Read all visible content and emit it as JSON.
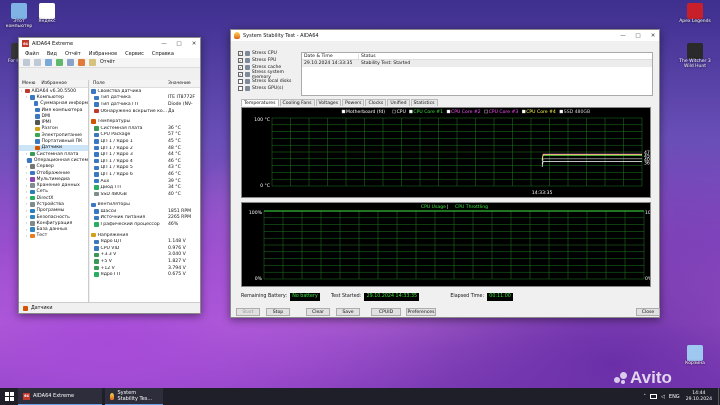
{
  "desktop": {
    "icons_left": [
      {
        "label": "Этот компьютер",
        "icon": "computer-icon",
        "color": "#7fb3e6"
      },
      {
        "label": "Яндекс",
        "icon": "yandex-icon",
        "color": "#ffffff"
      },
      {
        "label": "For Honor",
        "icon": "game-icon",
        "color": "#3a3a3a"
      }
    ],
    "icons_right": [
      {
        "label": "Apex Legends",
        "icon": "apex-icon",
        "color": "#c8202a"
      },
      {
        "label": "The Witcher 3 Wild Hunt",
        "icon": "witcher-icon",
        "color": "#2a2a2a"
      },
      {
        "label": "Корзина",
        "icon": "recycle-bin-icon",
        "color": "#9ec8ef"
      }
    ],
    "watermark": "Avito"
  },
  "aida": {
    "title": "AIDA64 Extreme",
    "menu": [
      "Файл",
      "Вид",
      "Отчёт",
      "Избранное",
      "Сервис",
      "Справка"
    ],
    "toolbar_report": "Отчёт",
    "tree_header": [
      "Меню",
      "Избранное"
    ],
    "tree": [
      {
        "label": "AIDA64 v6.30.5500",
        "indent": 0,
        "color": "#c0392b"
      },
      {
        "label": "Компьютер",
        "indent": 1,
        "color": "#3b78c2"
      },
      {
        "label": "Суммарная информ",
        "indent": 2,
        "color": "#3b78c2"
      },
      {
        "label": "Имя компьютера",
        "indent": 2,
        "color": "#3b78c2"
      },
      {
        "label": "DMI",
        "indent": 2,
        "color": "#3b78c2"
      },
      {
        "label": "IPMI",
        "indent": 2,
        "color": "#555555"
      },
      {
        "label": "Разгон",
        "indent": 2,
        "color": "#d4a017"
      },
      {
        "label": "Электропитание",
        "indent": 2,
        "color": "#3aa655"
      },
      {
        "label": "Портативный ПК",
        "indent": 2,
        "color": "#3b78c2"
      },
      {
        "label": "Датчики",
        "indent": 2,
        "color": "#d35400"
      },
      {
        "label": "Системная плата",
        "indent": 1,
        "color": "#3a9a55"
      },
      {
        "label": "Операционная система",
        "indent": 1,
        "color": "#3b78c2"
      },
      {
        "label": "Сервер",
        "indent": 1,
        "color": "#777777"
      },
      {
        "label": "Отображение",
        "indent": 1,
        "color": "#3b78c2"
      },
      {
        "label": "Мультимедиа",
        "indent": 1,
        "color": "#8e44ad"
      },
      {
        "label": "Хранение данных",
        "indent": 1,
        "color": "#7f8c8d"
      },
      {
        "label": "Сеть",
        "indent": 1,
        "color": "#2980b9"
      },
      {
        "label": "DirectX",
        "indent": 1,
        "color": "#27ae60"
      },
      {
        "label": "Устройства",
        "indent": 1,
        "color": "#7f8c8d"
      },
      {
        "label": "Программы",
        "indent": 1,
        "color": "#2980b9"
      },
      {
        "label": "Безопасность",
        "indent": 1,
        "color": "#2e86c1"
      },
      {
        "label": "Конфигурация",
        "indent": 1,
        "color": "#7f8c8d"
      },
      {
        "label": "База данных",
        "indent": 1,
        "color": "#2e86c1"
      },
      {
        "label": "Тест",
        "indent": 1,
        "color": "#e67e22"
      }
    ],
    "list_header": [
      "Поле",
      "Значение"
    ],
    "list": [
      {
        "type": "sec",
        "label": "Свойства датчика",
        "value": "",
        "color": "#3b78c2"
      },
      {
        "type": "row",
        "label": "Тип датчика",
        "value": "ITE IT8772F",
        "color": "#3b78c2"
      },
      {
        "type": "row",
        "label": "Тип датчика ГП",
        "value": "Diode (NV-",
        "color": "#3b78c2"
      },
      {
        "type": "row",
        "label": "Обнаружено вскрытие ко...",
        "value": "Да",
        "color": "#c0392b"
      },
      {
        "type": "gap"
      },
      {
        "type": "sec",
        "label": "Температуры",
        "value": "",
        "color": "#d35400"
      },
      {
        "type": "row",
        "label": "Системная плата",
        "value": "36 °C",
        "color": "#3a9a55"
      },
      {
        "type": "row",
        "label": "CPU Package",
        "value": "57 °C",
        "color": "#3b78c2"
      },
      {
        "type": "row",
        "label": "ЦП 1 / Ядро 1",
        "value": "45 °C",
        "color": "#3b78c2"
      },
      {
        "type": "row",
        "label": "ЦП 1 / Ядро 2",
        "value": "48 °C",
        "color": "#3b78c2"
      },
      {
        "type": "row",
        "label": "ЦП 1 / Ядро 3",
        "value": "44 °C",
        "color": "#3b78c2"
      },
      {
        "type": "row",
        "label": "ЦП 1 / Ядро 4",
        "value": "46 °C",
        "color": "#3b78c2"
      },
      {
        "type": "row",
        "label": "ЦП 1 / Ядро 5",
        "value": "43 °C",
        "color": "#3b78c2"
      },
      {
        "type": "row",
        "label": "ЦП 1 / Ядро 6",
        "value": "46 °C",
        "color": "#3b78c2"
      },
      {
        "type": "row",
        "label": "Aux",
        "value": "39 °C",
        "color": "#3b78c2"
      },
      {
        "type": "row",
        "label": "Диод ГП",
        "value": "34 °C",
        "color": "#27ae60"
      },
      {
        "type": "row",
        "label": "SSD 480GB",
        "value": "40 °C",
        "color": "#7f8c8d"
      },
      {
        "type": "gap"
      },
      {
        "type": "sec",
        "label": "Вентиляторы",
        "value": "",
        "color": "#3b78c2"
      },
      {
        "type": "row",
        "label": "Шасси",
        "value": "1851 RPM",
        "color": "#3b78c2"
      },
      {
        "type": "row",
        "label": "Источник питания",
        "value": "2265 RPM",
        "color": "#3b78c2"
      },
      {
        "type": "row",
        "label": "Графический процессор",
        "value": "46%",
        "color": "#27ae60"
      },
      {
        "type": "gap"
      },
      {
        "type": "sec",
        "label": "Напряжения",
        "value": "",
        "color": "#d4a017"
      },
      {
        "type": "row",
        "label": "Ядро ЦП",
        "value": "1.148 V",
        "color": "#3b78c2"
      },
      {
        "type": "row",
        "label": "CPU VID",
        "value": "0.976 V",
        "color": "#3b78c2"
      },
      {
        "type": "row",
        "label": "+3.3 V",
        "value": "3.040 V",
        "color": "#3a9a55"
      },
      {
        "type": "row",
        "label": "+5 V",
        "value": "1.827 V",
        "color": "#3a9a55"
      },
      {
        "type": "row",
        "label": "+12 V",
        "value": "3.794 V",
        "color": "#3a9a55"
      },
      {
        "type": "row",
        "label": "Ядро ГП",
        "value": "0.675 V",
        "color": "#27ae60"
      }
    ],
    "status": "Датчики"
  },
  "sst": {
    "title": "System Stability Test - AIDA64",
    "stress": [
      {
        "label": "Stress CPU",
        "checked": true
      },
      {
        "label": "Stress FPU",
        "checked": true
      },
      {
        "label": "Stress cache",
        "checked": true
      },
      {
        "label": "Stress system memory",
        "checked": true
      },
      {
        "label": "Stress local disks",
        "checked": false
      },
      {
        "label": "Stress GPU(s)",
        "checked": false
      }
    ],
    "log_header": [
      "Date & Time",
      "Status"
    ],
    "log": [
      {
        "datetime": "29.10.2024 14:33:35",
        "status": "Stability Test: Started"
      }
    ],
    "tabs": [
      "Temperatures",
      "Cooling Fans",
      "Voltages",
      "Powers",
      "Clocks",
      "Unified",
      "Statistics"
    ],
    "active_tab": "Temperatures",
    "temp_legend": [
      {
        "name": "Motherboard (fd)",
        "color": "#ffffff",
        "checked": true
      },
      {
        "name": "CPU",
        "color": "#ffffff",
        "checked": false
      },
      {
        "name": "CPU Core #1",
        "color": "#3fe63f",
        "checked": true
      },
      {
        "name": "CPU Core #2",
        "color": "#ff4fff",
        "checked": true
      },
      {
        "name": "CPU Core #3",
        "color": "#ff4fff",
        "checked": false
      },
      {
        "name": "CPU Core #4",
        "color": "#ffff4f",
        "checked": true
      },
      {
        "name": "SSD 480GB",
        "color": "#d6d6d6",
        "checked": true
      }
    ],
    "temp_ymax": "100 °C",
    "temp_ymin": "0 °C",
    "temp_time": "14:33:35",
    "temp_right_labels": [
      "47",
      "45",
      "40",
      "36"
    ],
    "cpu_title": "CPU Usage",
    "cpu_title_sep": " | ",
    "cpu_throttle": "CPU Throttling",
    "cpu_ymax": "100%",
    "cpu_ymin": "0%",
    "cpu_right_max": "100%",
    "cpu_right_min": "0%",
    "battery_label": "Remaining Battery:",
    "battery_value": "No battery",
    "started_label": "Test Started:",
    "started_value": "29.10.2024 14:33:35",
    "elapsed_label": "Elapsed Time:",
    "elapsed_value": "00:11:00",
    "buttons": [
      "Start",
      "Stop",
      "Clear",
      "Save",
      "CPUID",
      "Preferences",
      "Close"
    ]
  },
  "chart_data": [
    {
      "type": "line",
      "title": "Temperatures",
      "ylim": [
        0,
        100
      ],
      "x": [
        "14:33:35"
      ],
      "series": [
        {
          "name": "Motherboard (fd)",
          "values": [
            36
          ]
        },
        {
          "name": "CPU Core #1",
          "values": [
            45
          ]
        },
        {
          "name": "CPU Core #2",
          "values": [
            47
          ]
        },
        {
          "name": "CPU Core #4",
          "values": [
            46
          ]
        },
        {
          "name": "SSD 480GB",
          "values": [
            40
          ]
        }
      ],
      "grid": true
    },
    {
      "type": "line",
      "title": "CPU Usage",
      "ylim": [
        0,
        100
      ],
      "series": [
        {
          "name": "CPU Usage",
          "values": [
            100
          ]
        }
      ],
      "grid": true
    }
  ],
  "taskbar": {
    "items": [
      {
        "label": "AIDA64 Extreme",
        "icon": "aida-icon"
      },
      {
        "label": "System Stability Tes...",
        "icon": "aida-flame-icon"
      }
    ],
    "lang": "ENG",
    "time": "14:44",
    "date": "29.10.2024"
  }
}
